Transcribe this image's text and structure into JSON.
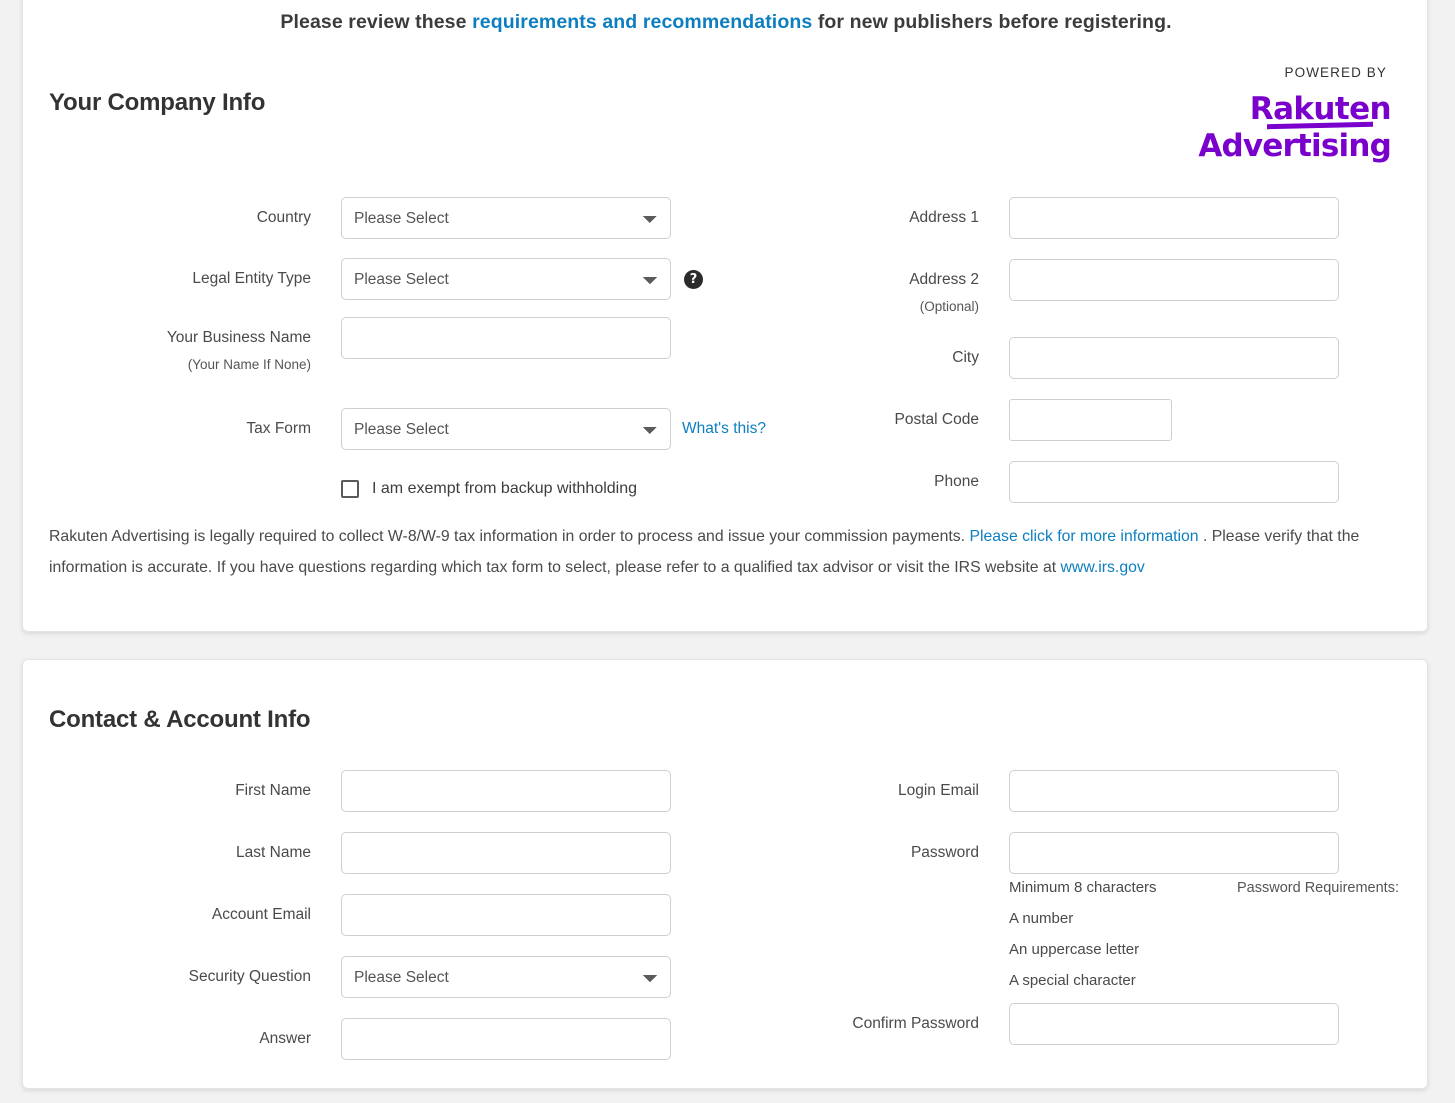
{
  "banner": {
    "before": "Please review these ",
    "link": "requirements and recommendations",
    "after": " for new publishers before registering."
  },
  "powered": {
    "label": "POWERED BY",
    "logo_line1": "Rakuten",
    "logo_line2": "Advertising",
    "brand_color": "#7a00cc"
  },
  "company_section": {
    "title": "Your Company Info",
    "fields": {
      "country": {
        "label": "Country",
        "value": "Please Select"
      },
      "legal_entity_type": {
        "label": "Legal Entity Type",
        "value": "Please Select",
        "help_icon": "question-mark-icon"
      },
      "business_name": {
        "label": "Your Business Name",
        "sublabel": "(Your Name If None)",
        "value": "",
        "placeholder": ""
      },
      "tax_form": {
        "label": "Tax Form",
        "value": "Please Select",
        "link": "What's this?"
      },
      "address1": {
        "label": "Address 1",
        "value": "",
        "placeholder": ""
      },
      "address2": {
        "label": "Address 2",
        "sublabel": "(Optional)",
        "value": "",
        "placeholder": ""
      },
      "city": {
        "label": "City",
        "value": "",
        "placeholder": ""
      },
      "postal_code": {
        "label": "Postal Code",
        "value": "",
        "placeholder": ""
      },
      "phone": {
        "label": "Phone",
        "value": "",
        "placeholder": ""
      }
    },
    "checkbox": {
      "label": "I am exempt from backup withholding",
      "checked": false
    },
    "legal": {
      "part1": "Rakuten Advertising is legally required to collect W-8/W-9 tax information in order to process and issue your commission payments. ",
      "link1": "Please click for more information",
      "part2": " . Please verify that the information is accurate. If you have questions regarding which tax form to select, please refer to a qualified tax advisor or visit the IRS website at ",
      "link2": "www.irs.gov"
    }
  },
  "contact_section": {
    "title": "Contact & Account Info",
    "fields": {
      "first_name": {
        "label": "First Name",
        "value": "",
        "placeholder": ""
      },
      "last_name": {
        "label": "Last Name",
        "value": "",
        "placeholder": ""
      },
      "account_email": {
        "label": "Account Email",
        "value": "",
        "placeholder": ""
      },
      "security_question": {
        "label": "Security Question",
        "value": "Please Select"
      },
      "answer": {
        "label": "Answer",
        "value": "",
        "placeholder": ""
      },
      "login_email": {
        "label": "Login Email",
        "value": "",
        "placeholder": ""
      },
      "password": {
        "label": "Password",
        "value": "",
        "placeholder": ""
      },
      "confirm_password": {
        "label": "Confirm Password",
        "value": "",
        "placeholder": ""
      }
    },
    "password_requirements": {
      "label": "Password Requirements:",
      "items": [
        "Minimum 8 characters",
        "A number",
        "An uppercase letter",
        "A special character"
      ]
    }
  },
  "colors": {
    "link": "#0d7fc0",
    "text": "#4a4a4a",
    "card_bg": "#ffffff",
    "page_bg": "#f2f2f2",
    "border": "#cfcfcf"
  }
}
